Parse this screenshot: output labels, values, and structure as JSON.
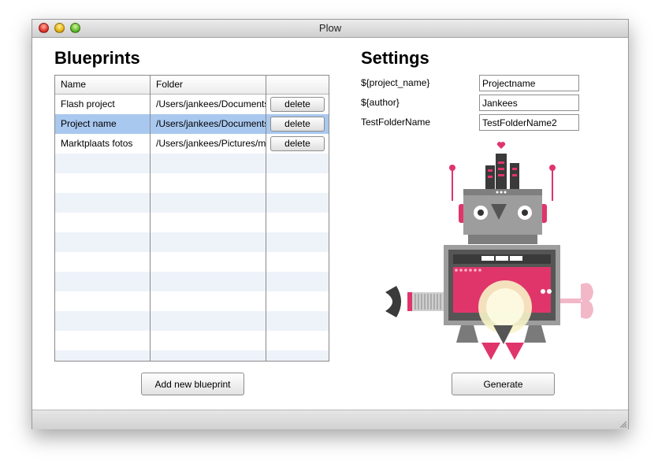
{
  "window": {
    "title": "Plow"
  },
  "blueprints": {
    "heading": "Blueprints",
    "columns": {
      "name": "Name",
      "folder": "Folder"
    },
    "rows": [
      {
        "name": "Flash project",
        "folder": "/Users/jankees/Documents/Flash project",
        "action": "delete",
        "selected": false
      },
      {
        "name": "Project name",
        "folder": "/Users/jankees/Documents/Project name",
        "action": "delete",
        "selected": true
      },
      {
        "name": "Marktplaats fotos",
        "folder": "/Users/jankees/Pictures/marktplaats",
        "action": "delete",
        "selected": false
      }
    ],
    "add_button": "Add new blueprint"
  },
  "settings": {
    "heading": "Settings",
    "fields": [
      {
        "label": "${project_name}",
        "value": "Projectname"
      },
      {
        "label": "${author}",
        "value": "Jankees"
      },
      {
        "label": "TestFolderName",
        "value": "TestFolderName2"
      }
    ],
    "generate_button": "Generate"
  },
  "colors": {
    "selected_row": "#a9c8ef",
    "stripe": "#eef3fa",
    "robot_pink": "#e0356b",
    "robot_gray": "#9d9d9d"
  }
}
